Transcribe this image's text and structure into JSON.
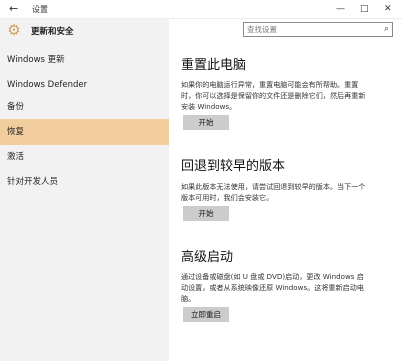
{
  "window": {
    "title": "设置",
    "back_icon": "back-arrow-icon",
    "controls": {
      "minimize": "—",
      "maximize": "□",
      "close": "✕"
    }
  },
  "sidebar": {
    "icon": "gear-icon",
    "title": "更新和安全",
    "items": [
      {
        "label": "Windows 更新",
        "active": false
      },
      {
        "label": "Windows Defender",
        "active": false
      },
      {
        "label": "备份",
        "active": false
      },
      {
        "label": "恢复",
        "active": true
      },
      {
        "label": "激活",
        "active": false
      },
      {
        "label": "针对开发人员",
        "active": false
      }
    ]
  },
  "search": {
    "placeholder": "查找设置",
    "icon": "search-icon"
  },
  "sections": [
    {
      "title": "重置此电脑",
      "desc_lines": [
        "如果你的电脑运行异常，重置电脑可能会有所帮助。重置",
        "时，你可以选择是保留你的文件还是删除它们，然后再重新",
        "安装 Windows。"
      ],
      "button": "开始"
    },
    {
      "title": "回退到较早的版本",
      "desc_lines": [
        "如果此版本无法使用，请尝试回退到较早的版本。当下一个",
        "版本可用时，我们会安装它。"
      ],
      "button": "开始"
    },
    {
      "title": "高级启动",
      "desc_lines": [
        "通过设备或磁盘(如 U 盘或 DVD)启动，更改 Windows 启",
        "动设置，或者从系统映像还原 Windows。这将重新启动电",
        "脑。"
      ],
      "button": "立即重启"
    }
  ],
  "colors": {
    "accent": "#f2ce9f",
    "sidebar_bg": "#f2f2f2",
    "button_bg": "#cccccc",
    "gear": "#d2a062"
  }
}
